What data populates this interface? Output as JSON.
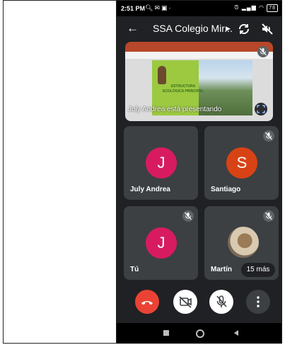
{
  "status_bar": {
    "time": "2:51 PM",
    "battery": "78",
    "notification_icons": [
      "search-icon",
      "mail-icon",
      "app-icon"
    ],
    "system_icons": [
      "alarm-icon",
      "signal-icon",
      "wifi-icon",
      "battery-icon"
    ]
  },
  "header": {
    "title": "SSA Colegio Mir...",
    "back_icon": "arrow-back-icon",
    "switch_camera_icon": "switch-camera-icon",
    "audio_icon": "audio-off-icon"
  },
  "presentation": {
    "label": "July Andrea está presentando",
    "slide_text": "ESTRUCTURA ECOLÓGICA PRINCIPAL"
  },
  "participants": [
    {
      "name": "July Andrea",
      "initial": "J",
      "color": "#d81b60",
      "muted": false
    },
    {
      "name": "Santiago",
      "initial": "S",
      "color": "#d84315",
      "muted": true
    },
    {
      "name": "Tú",
      "initial": "J",
      "color": "#d81b60",
      "muted": true
    },
    {
      "name": "Martín",
      "initial": "",
      "color": "#8d6e63",
      "muted": true
    }
  ],
  "more_participants": "15 más",
  "controls": {
    "end_call_color": "#ea4335",
    "camera_icon": "camera-off-icon",
    "mic_icon": "mic-off-icon",
    "more_icon": "more-vertical-icon"
  },
  "nav": [
    "recents-icon",
    "home-icon",
    "back-triangle-icon"
  ]
}
